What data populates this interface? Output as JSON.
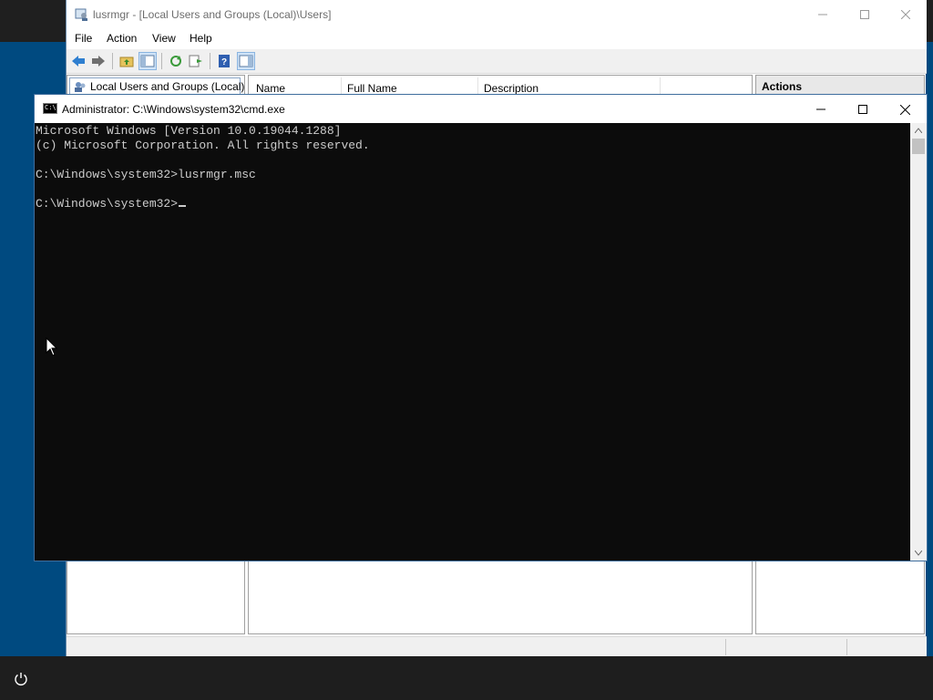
{
  "mmc": {
    "title": "lusrmgr - [Local Users and Groups (Local)\\Users]",
    "menu": [
      "File",
      "Action",
      "View",
      "Help"
    ],
    "tree_root": "Local Users and Groups (Local)",
    "columns": [
      "Name",
      "Full Name",
      "Description"
    ],
    "actions_header": "Actions"
  },
  "cmd": {
    "title": "Administrator: C:\\Windows\\system32\\cmd.exe",
    "lines": [
      "Microsoft Windows [Version 10.0.19044.1288]",
      "(c) Microsoft Corporation. All rights reserved.",
      "",
      "C:\\Windows\\system32>lusrmgr.msc",
      "",
      "C:\\Windows\\system32>"
    ]
  },
  "colors": {
    "desktop": "#004a80",
    "console_bg": "#0c0c0c",
    "console_fg": "#cccccc",
    "taskbar": "#1e1e1e"
  },
  "icons": [
    "mmc-app-icon",
    "back-arrow-icon",
    "forward-arrow-icon",
    "up-folder-icon",
    "show-hide-tree-icon",
    "refresh-icon",
    "export-list-icon",
    "help-icon",
    "action-pane-icon",
    "users-folder-icon",
    "cmd-app-icon",
    "minimize-icon",
    "maximize-icon",
    "close-icon",
    "power-icon",
    "mouse-pointer-icon"
  ]
}
